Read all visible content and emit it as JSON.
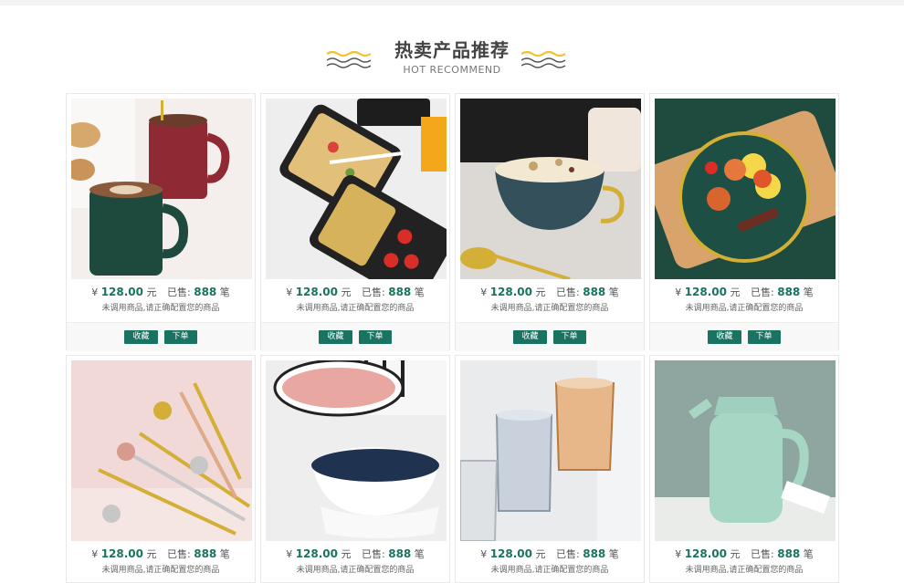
{
  "section": {
    "title": "热卖产品推荐",
    "subtitle": "HOT RECOMMEND",
    "accent_color": "#f2c230",
    "wave_dark_color": "#555555"
  },
  "theme": {
    "primary": "#1a7360"
  },
  "products": [
    {
      "image_icon": "coffee-mugs-photo",
      "currency": "¥",
      "price": "128.00",
      "unit": "元",
      "sold_label": "已售:",
      "sold": "888",
      "sold_unit": "笔",
      "desc": "未调用商品,请正确配置您的商品",
      "fav_label": "收藏",
      "order_label": "下单"
    },
    {
      "image_icon": "lunch-box-photo",
      "currency": "¥",
      "price": "128.00",
      "unit": "元",
      "sold_label": "已售:",
      "sold": "888",
      "sold_unit": "笔",
      "desc": "未调用商品,请正确配置您的商品",
      "fav_label": "收藏",
      "order_label": "下单"
    },
    {
      "image_icon": "cereal-bowl-photo",
      "currency": "¥",
      "price": "128.00",
      "unit": "元",
      "sold_label": "已售:",
      "sold": "888",
      "sold_unit": "笔",
      "desc": "未调用商品,请正确配置您的商品",
      "fav_label": "收藏",
      "order_label": "下单"
    },
    {
      "image_icon": "green-plate-photo",
      "currency": "¥",
      "price": "128.00",
      "unit": "元",
      "sold_label": "已售:",
      "sold": "888",
      "sold_unit": "笔",
      "desc": "未调用商品,请正确配置您的商品",
      "fav_label": "收藏",
      "order_label": "下单"
    },
    {
      "image_icon": "spoons-forks-photo",
      "currency": "¥",
      "price": "128.00",
      "unit": "元",
      "sold_label": "已售:",
      "sold": "888",
      "sold_unit": "笔",
      "desc": "未调用商品,请正确配置您的商品"
    },
    {
      "image_icon": "ceramic-bowls-photo",
      "currency": "¥",
      "price": "128.00",
      "unit": "元",
      "sold_label": "已售:",
      "sold": "888",
      "sold_unit": "笔",
      "desc": "未调用商品,请正确配置您的商品"
    },
    {
      "image_icon": "glass-cups-photo",
      "currency": "¥",
      "price": "128.00",
      "unit": "元",
      "sold_label": "已售:",
      "sold": "888",
      "sold_unit": "笔",
      "desc": "未调用商品,请正确配置您的商品"
    },
    {
      "image_icon": "thermos-jug-photo",
      "currency": "¥",
      "price": "128.00",
      "unit": "元",
      "sold_label": "已售:",
      "sold": "888",
      "sold_unit": "笔",
      "desc": "未调用商品,请正确配置您的商品"
    }
  ]
}
